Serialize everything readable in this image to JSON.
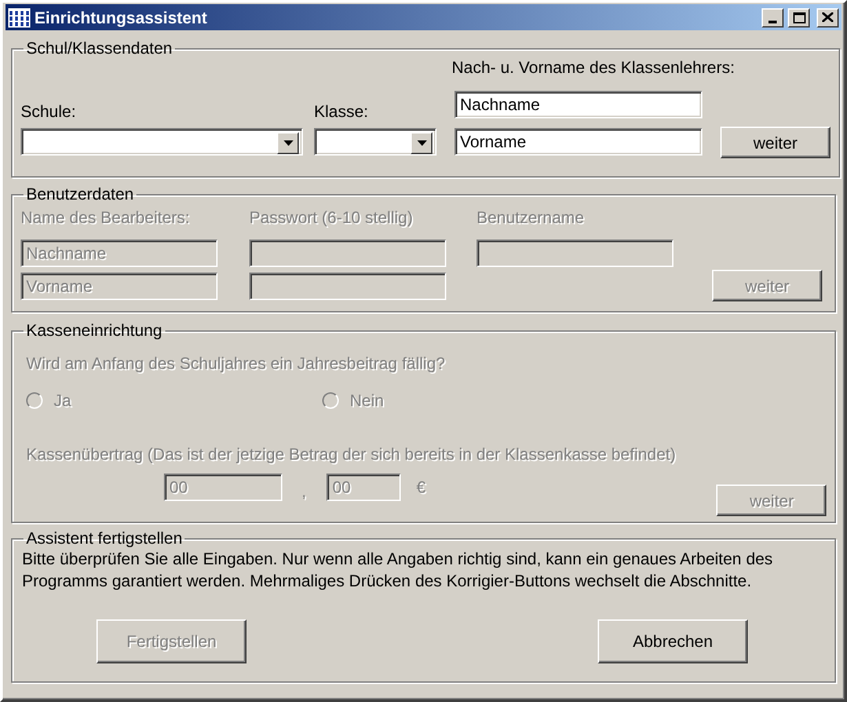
{
  "window": {
    "title": "Einrichtungsassistent"
  },
  "school_section": {
    "title": "Schul/Klassendaten",
    "disabled": false,
    "teacher_label": "Nach- u. Vorname des Klassenlehrers:",
    "school_label": "Schule:",
    "class_label": "Klasse:",
    "last_name": "Nachname",
    "first_name": "Vorname",
    "next_button": "weiter"
  },
  "user_section": {
    "title": "Benutzerdaten",
    "disabled": true,
    "name_label": "Name des Bearbeiters:",
    "password_label": "Passwort (6-10 stellig)",
    "username_label": "Benutzername",
    "last_name": "Nachname",
    "first_name": "Vorname",
    "next_button": "weiter"
  },
  "cash_section": {
    "title": "Kasseneinrichtung",
    "disabled": true,
    "question": "Wird am Anfang des Schuljahres ein Jahresbeitrag fällig?",
    "options": [
      {
        "label": "Ja",
        "selected": false
      },
      {
        "label": "Nein",
        "selected": false
      }
    ],
    "transfer_label": "Kassenübertrag (Das ist der jetzige Betrag der sich bereits in der Klassenkasse befindet)",
    "euros": "00",
    "separator": ",",
    "cents": "00",
    "currency": "€",
    "next_button": "weiter"
  },
  "finish_section": {
    "title": "Assistent fertigstellen",
    "text": "Bitte überprüfen Sie alle Eingaben. Nur wenn alle Angaben richtig sind, kann ein genaues Arbeiten des Programms garantiert werden. Mehrmaliges Drücken des Korrigier-Buttons wechselt die Abschnitte.",
    "buttons": [
      {
        "label": "Fertigstellen",
        "disabled": true
      },
      {
        "label": "Abbrechen",
        "disabled": false
      }
    ]
  }
}
